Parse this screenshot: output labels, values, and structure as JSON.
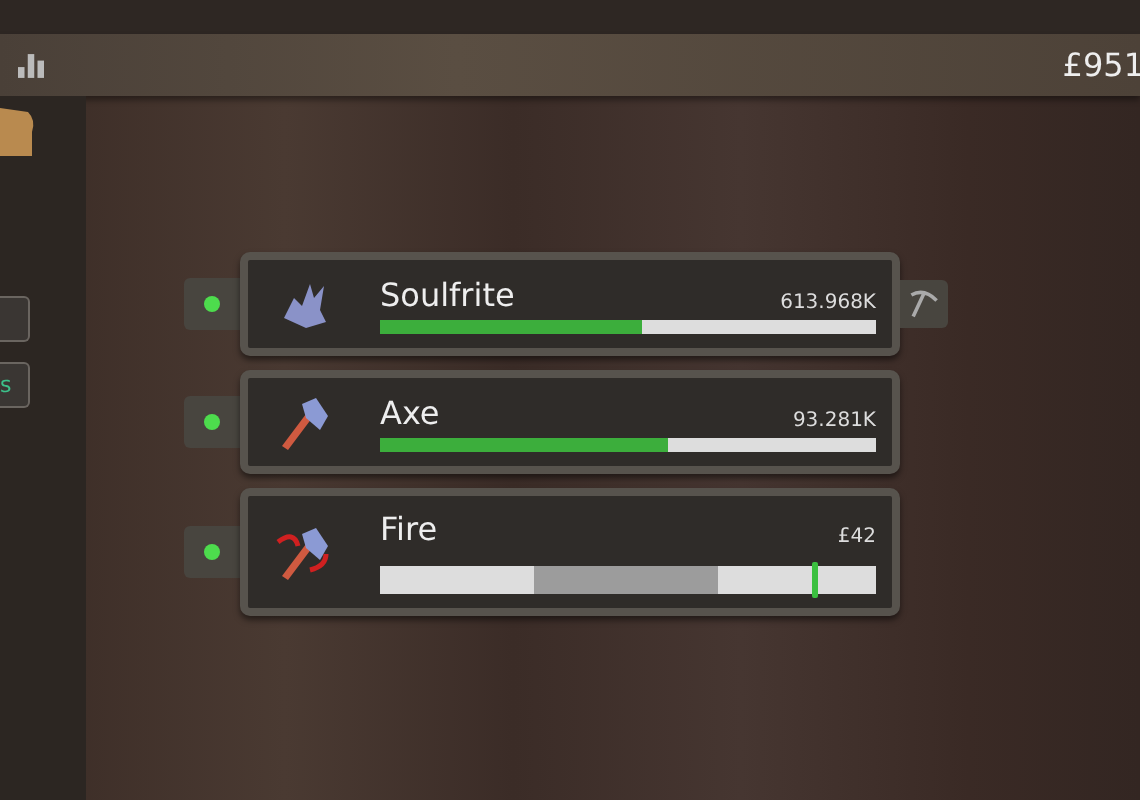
{
  "top_bar": {
    "money": "£951"
  },
  "side_buttons": [
    {
      "kind": "blank"
    },
    {
      "kind": "labeled",
      "label": "s"
    }
  ],
  "skills": [
    {
      "kind": "progress",
      "name": "Soulfrite",
      "value": "613.968K",
      "level": 0.53,
      "active": true,
      "tool": true
    },
    {
      "kind": "progress",
      "name": "Axe",
      "value": "93.281K",
      "level": 0.58,
      "active": true,
      "tool": false
    },
    {
      "kind": "timing",
      "name": "Fire",
      "value": "£42",
      "level": 0.88,
      "active": true,
      "tool": false
    }
  ]
}
